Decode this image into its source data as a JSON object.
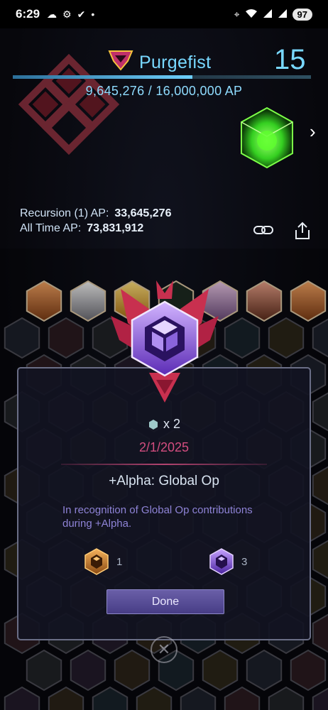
{
  "status_bar": {
    "time": "6:29",
    "battery": "97",
    "left_icons": [
      "cloud-icon",
      "settings-icon",
      "check-icon",
      "dot-icon"
    ],
    "right_icons": [
      "location-icon",
      "wifi-icon",
      "signal-icon",
      "signal-icon"
    ]
  },
  "profile": {
    "agent_name": "Purgefist",
    "level": "15",
    "ap_progress_text": "9,645,276 / 16,000,000 AP",
    "ap_progress_fraction": 0.603,
    "recursion_label": "Recursion (1) AP:",
    "recursion_value": "33,645,276",
    "all_time_label": "All Time AP:",
    "all_time_value": "73,831,912"
  },
  "modal": {
    "count": "x 2",
    "date": "2/1/2025",
    "title": "+Alpha: Global Op",
    "description": "In recognition of Global Op contributions during +Alpha.",
    "tier_bronze_count": "1",
    "tier_purple_count": "3",
    "done_label": "Done"
  },
  "colors": {
    "accent_cyan": "#78d8ff",
    "accent_pink": "#d34d7f",
    "modal_text_purple": "#8e83d6"
  }
}
